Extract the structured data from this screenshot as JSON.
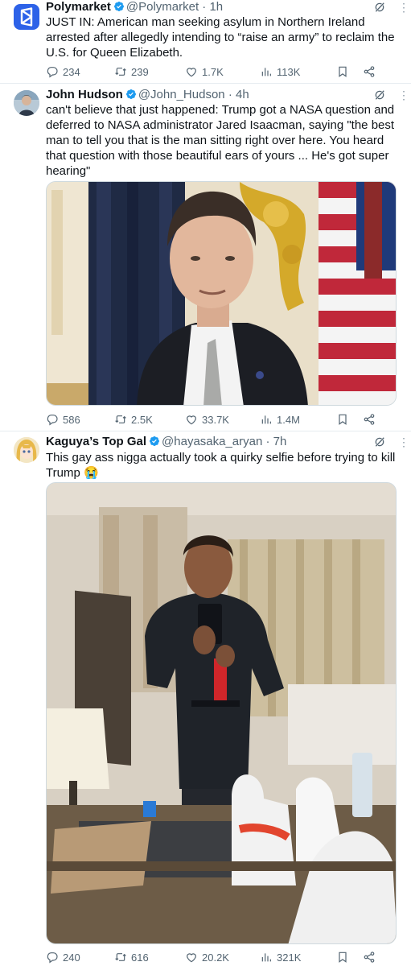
{
  "tweets": [
    {
      "name": "Polymarket",
      "handle": "@Polymarket",
      "time": "· 1h",
      "text": "JUST IN: American man seeking asylum in Northern Ireland arrested after allegedly intending to “raise an army” to reclaim the U.S. for Queen Elizabeth.",
      "replies": "234",
      "retweets": "239",
      "likes": "1.7K",
      "views": "113K"
    },
    {
      "name": "John Hudson",
      "handle": "@John_Hudson",
      "time": "· 4h",
      "text": "can't believe that just happened: Trump got a NASA question and deferred to NASA administrator Jared Isaacman, saying \"the best man to tell you that is the man sitting right over here. You heard that question with those beautiful ears of yours ... He's got super hearing\"",
      "replies": "586",
      "retweets": "2.5K",
      "likes": "33.7K",
      "views": "1.4M"
    },
    {
      "name": "Kaguya’s Top Gal",
      "handle": "@hayasaka_aryan",
      "time": "· 7h",
      "text": "This gay ass nigga actually took a quirky selfie before trying to kill Trump 😭",
      "replies": "240",
      "retweets": "616",
      "likes": "20.2K",
      "views": "321K"
    }
  ],
  "colors": {
    "verified": "#1d9bf0",
    "polymarket_brand": "#2d62e8",
    "text_secondary": "#536471"
  },
  "icons": [
    "polymarket-logo",
    "verified-badge-icon",
    "grok-icon",
    "more-icon",
    "reply-icon",
    "retweet-icon",
    "like-icon",
    "views-icon",
    "bookmark-icon",
    "share-icon"
  ]
}
